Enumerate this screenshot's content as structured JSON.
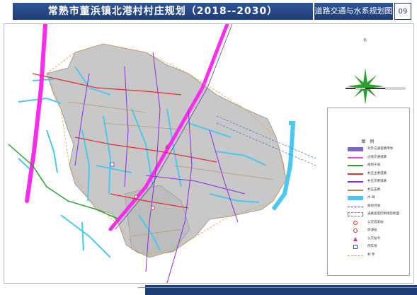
{
  "header": {
    "title": "常熟市董浜镇北港村村庄规划（2018--2030）",
    "sheet_title": "道路交通与水系规划图",
    "sheet_number": "09"
  },
  "compass": {
    "north_label": "北"
  },
  "legend": {
    "title": "图 例",
    "items": [
      {
        "label": "对外交通道路用地",
        "color": "#7b68c8",
        "style": "fill"
      },
      {
        "label": "过境交通道路",
        "color": "#ff3cf0",
        "style": "line"
      },
      {
        "label": "规划干道",
        "color": "#2ca02c",
        "style": "line"
      },
      {
        "label": "村庄主要道路",
        "color": "#e03030",
        "style": "line"
      },
      {
        "label": "村庄次要道路",
        "color": "#8a2be2",
        "style": "line"
      },
      {
        "label": "村庄支路",
        "color": "#b08a60",
        "style": "line"
      },
      {
        "label": "水 域",
        "color": "#4cc7f0",
        "style": "fill"
      },
      {
        "label": "规划河道",
        "color": "#3050c0",
        "style": "dash"
      },
      {
        "label": "道路宽度控制线及断面",
        "color": "#777777",
        "style": "dashbox"
      },
      {
        "label": "公交首末站",
        "color": "#cc3333",
        "style": "circle"
      },
      {
        "label": "加油站",
        "color": "#cc3333",
        "style": "circle"
      },
      {
        "label": "公交站点",
        "color": "#cc3399",
        "style": "triangle"
      },
      {
        "label": "停车场",
        "color": "#3050c0",
        "style": "box"
      },
      {
        "label": "村 界",
        "color": "#f0a030",
        "style": "dash"
      }
    ]
  },
  "map": {
    "colors": {
      "village_fill": "#c8c8c8",
      "village_edge": "#8f8f8f",
      "water": "#4cc7f0",
      "highway": "#ff2cf0",
      "trunk_road": "#2ca02c",
      "main_road": "#e03030",
      "secondary_road": "#8a2be2",
      "branch_road": "#b08a60"
    }
  }
}
